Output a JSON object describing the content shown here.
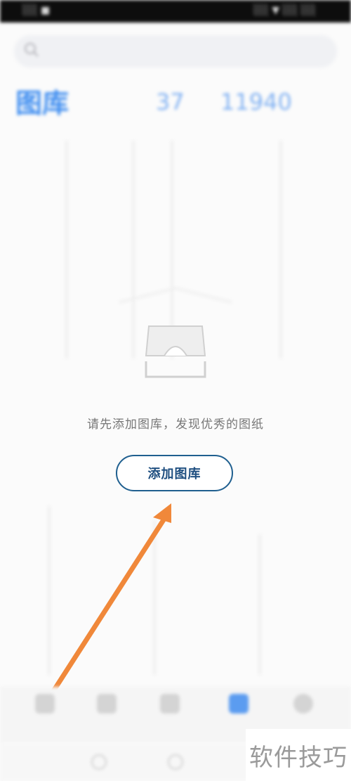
{
  "status_bar": {
    "left": "░░ ■",
    "right": "░░ ▼ ░░ ░░"
  },
  "search": {
    "placeholder": ""
  },
  "header": {
    "title": "图库",
    "subtitle": "",
    "stat1_value": "37",
    "stat1_unit": "",
    "stat2_value": "11940",
    "stat2_unit": ""
  },
  "empty_state": {
    "message": "请先添加图库，发现优秀的图纸",
    "button_label": "添加图库"
  },
  "bottom_nav": {
    "items": [
      {
        "label": "",
        "icon": "home-icon",
        "active": false
      },
      {
        "label": "",
        "icon": "cloud-icon",
        "active": false
      },
      {
        "label": "",
        "icon": "grid-icon",
        "active": false
      },
      {
        "label": "",
        "icon": "gallery-icon",
        "active": true
      },
      {
        "label": "",
        "icon": "profile-icon",
        "active": false
      }
    ]
  },
  "watermark": {
    "text": "软件技巧"
  },
  "colors": {
    "accent": "#3e8df0",
    "button_border": "#1f5f8f",
    "arrow": "#f0883a"
  }
}
